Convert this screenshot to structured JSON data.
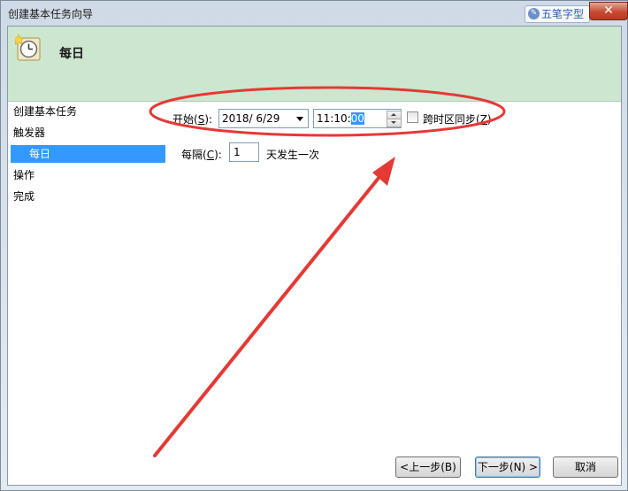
{
  "window": {
    "title": "创建基本任务向导",
    "close_label": "✕"
  },
  "watermark": {
    "text": "五笔字型"
  },
  "header": {
    "title": "每日"
  },
  "nav": {
    "items": [
      "创建基本任务",
      "触发器",
      "每日",
      "操作",
      "完成"
    ],
    "selected": "每日"
  },
  "start": {
    "label": "开始(",
    "key": "S",
    "label_end": "):",
    "date": "2018/  6/29",
    "time_prefix": "11:10:",
    "time_selected": "00"
  },
  "sync": {
    "label": "跨时区同步(",
    "key": "Z",
    "label_end": ")",
    "checked": false
  },
  "recur": {
    "label": "每隔(",
    "key": "C",
    "label_end": "):",
    "value": "1",
    "suffix": "天发生一次"
  },
  "buttons": {
    "back": "<上一步(B)",
    "next": "下一步(N) >",
    "cancel": "取消"
  },
  "colors": {
    "header_bg": "#cde6cf",
    "selection": "#3399ff",
    "annotation": "#e53935"
  }
}
